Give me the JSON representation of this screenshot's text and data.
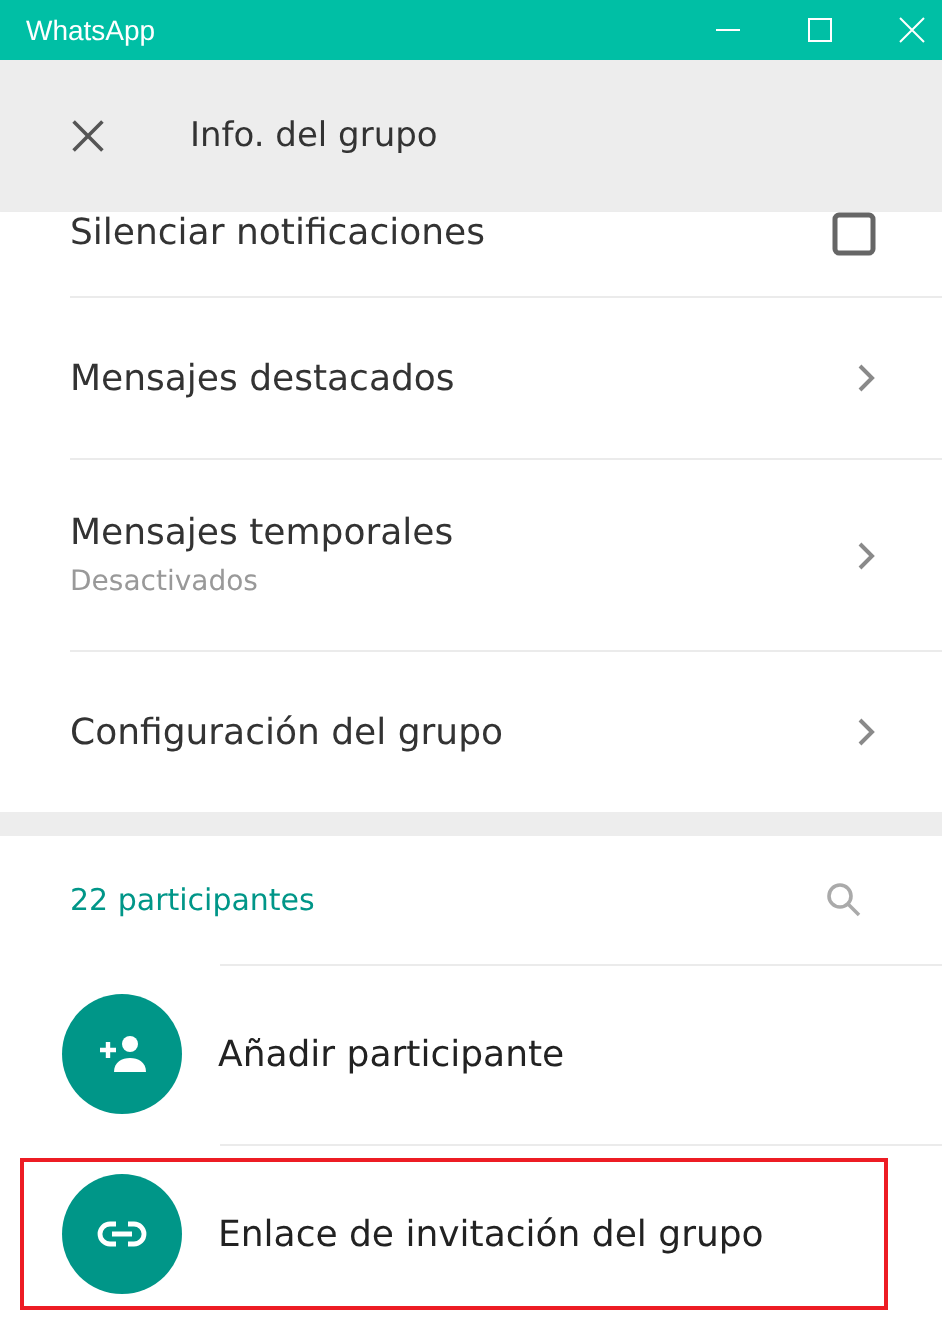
{
  "window": {
    "title": "WhatsApp"
  },
  "header": {
    "title": "Info. del grupo"
  },
  "settings": [
    {
      "kind": "checkbox",
      "label": "Silenciar notificaciones",
      "checked": false
    },
    {
      "kind": "link",
      "label": "Mensajes destacados"
    },
    {
      "kind": "link",
      "label": "Mensajes temporales",
      "subtitle": "Desactivados"
    },
    {
      "kind": "link",
      "label": "Configuración del grupo"
    }
  ],
  "participants": {
    "count": "22 participantes",
    "actions": [
      {
        "kind": "add",
        "label": "Añadir participante",
        "highlighted": false
      },
      {
        "kind": "link",
        "label": "Enlace de invitación del grupo",
        "highlighted": true
      }
    ]
  }
}
